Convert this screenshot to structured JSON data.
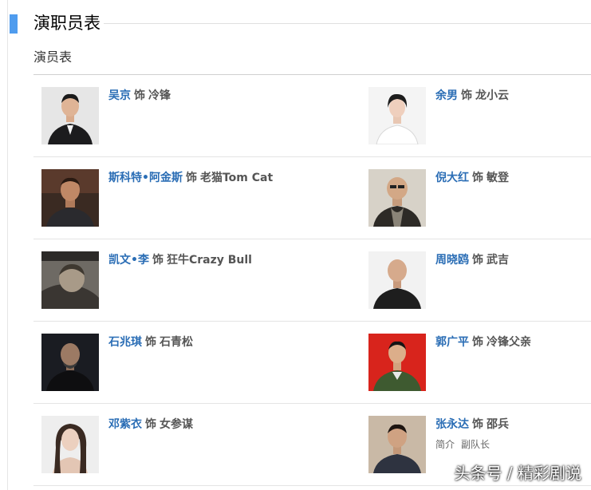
{
  "section": {
    "title": "演职员表"
  },
  "cast": {
    "heading": "演员表",
    "as_word": "饰",
    "rows": [
      {
        "left": {
          "actor": "吴京",
          "role": "冷锋"
        },
        "right": {
          "actor": "余男",
          "role": "龙小云"
        }
      },
      {
        "left": {
          "actor": "斯科特•阿金斯",
          "role": "老猫Tom Cat"
        },
        "right": {
          "actor": "倪大红",
          "role": "敏登"
        }
      },
      {
        "left": {
          "actor": "凯文•李",
          "role": "狂牛Crazy Bull"
        },
        "right": {
          "actor": "周晓鸥",
          "role": "武吉"
        }
      },
      {
        "left": {
          "actor": "石兆琪",
          "role": "石青松"
        },
        "right": {
          "actor": "郭广平",
          "role": "冷锋父亲"
        }
      },
      {
        "left": {
          "actor": "邓紫衣",
          "role": "女参谋"
        },
        "right": {
          "actor": "张永达",
          "role": "邵兵",
          "extra_label": "简介",
          "extra_value": "副队长"
        }
      }
    ]
  },
  "watermark": "头条号 / 精彩剧说",
  "colors": {
    "accent": "#4f9cee",
    "link": "#2a6db5"
  }
}
